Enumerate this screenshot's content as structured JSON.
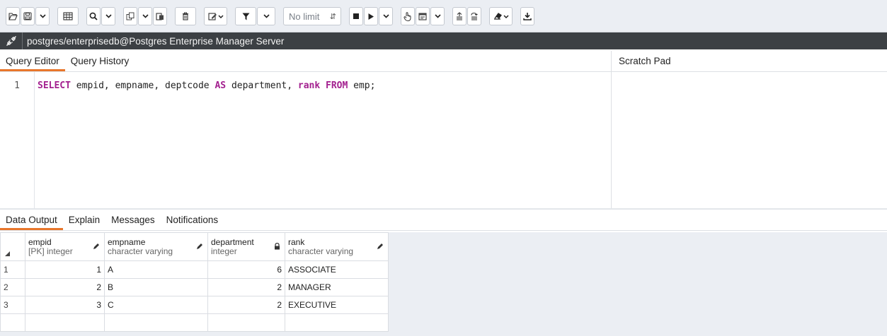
{
  "toolbar": {
    "row_limit": "No limit",
    "icons": [
      "open-file-icon",
      "save-icon",
      "chevron-down-icon",
      "filter-table-icon",
      "find-icon",
      "chevron-down-icon",
      "copy-icon",
      "chevron-down-icon",
      "paste-icon",
      "delete-icon",
      "edit-icon",
      "filter-icon",
      "chevron-down-icon",
      "stop-icon",
      "execute-icon",
      "chevron-down-icon",
      "explain-icon",
      "grid-icon",
      "chevron-down-icon",
      "commit-icon",
      "rollback-icon",
      "clear-icon",
      "download-icon"
    ]
  },
  "connection": {
    "label": "postgres/enterprisedb@Postgres Enterprise Manager Server",
    "icon": "connection-icon"
  },
  "editor_tabs": [
    "Query Editor",
    "Query History"
  ],
  "scratch_pad": {
    "title": "Scratch Pad"
  },
  "editor": {
    "line_number": "1",
    "tokens": [
      {
        "text": "SELECT",
        "kw": true
      },
      {
        "text": " empid, empname, deptcode ",
        "kw": false
      },
      {
        "text": "AS",
        "kw": true
      },
      {
        "text": " department, ",
        "kw": false
      },
      {
        "text": "rank",
        "kw": true
      },
      {
        "text": " ",
        "kw": false
      },
      {
        "text": "FROM",
        "kw": true
      },
      {
        "text": " emp;",
        "kw": false
      }
    ]
  },
  "output_tabs": [
    "Data Output",
    "Explain",
    "Messages",
    "Notifications"
  ],
  "grid": {
    "columns": [
      {
        "name": "empid",
        "type": "[PK] integer",
        "icon": "pencil-icon"
      },
      {
        "name": "empname",
        "type": "character varying",
        "icon": "pencil-icon"
      },
      {
        "name": "department",
        "type": "integer",
        "icon": "lock-icon"
      },
      {
        "name": "rank",
        "type": "character varying",
        "icon": "pencil-icon"
      }
    ],
    "rows": [
      {
        "num": "1",
        "cells": [
          "1",
          "A",
          "6",
          "ASSOCIATE"
        ]
      },
      {
        "num": "2",
        "cells": [
          "2",
          "B",
          "2",
          "MANAGER"
        ]
      },
      {
        "num": "3",
        "cells": [
          "3",
          "C",
          "2",
          "EXECUTIVE"
        ]
      }
    ]
  },
  "colors": {
    "accent": "#e8762b",
    "keyword": "#a3208f",
    "connection_bar": "#3c4044",
    "toolbar_bg": "#ebeef3"
  }
}
